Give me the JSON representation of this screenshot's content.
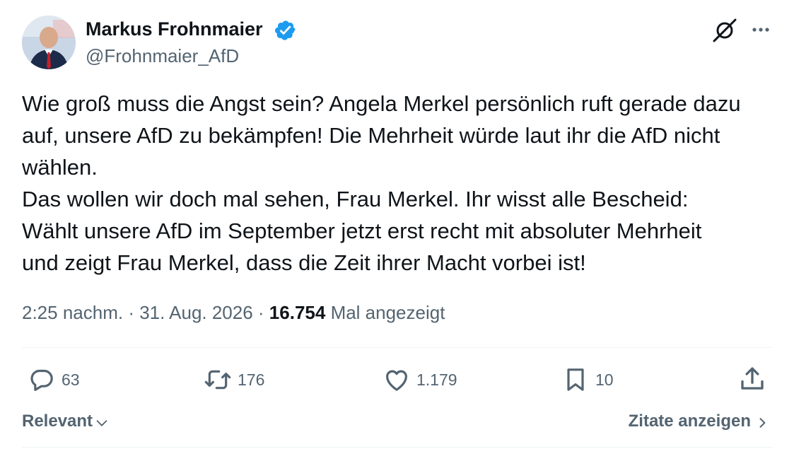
{
  "author": {
    "name": "Markus Frohnmaier",
    "handle": "@Frohnmaier_AfD",
    "verified": true,
    "verified_color": "#1d9bf0"
  },
  "tweet": {
    "text": "Wie groß muss die Angst sein? Angela Merkel persönlich ruft gerade dazu\nauf, unsere AfD zu bekämpfen! Die Mehrheit würde laut ihr die AfD nicht\nwählen.\nDas wollen wir doch mal sehen, Frau Merkel. Ihr wisst alle Bescheid:\nWählt unsere AfD im September jetzt erst recht mit absoluter Mehrheit\nund zeigt Frau Merkel, dass die Zeit ihrer Macht vorbei ist!",
    "time": "2:25 nachm.",
    "date": "31. Aug. 2026",
    "views_count": "16.754",
    "views_label": "Mal angezeigt"
  },
  "actions": {
    "replies": "63",
    "reposts": "176",
    "likes": "1.179",
    "bookmarks": "10"
  },
  "footer": {
    "sort_label": "Relevant",
    "quotes_label": "Zitate anzeigen"
  },
  "icons": [
    "grok-icon",
    "more-icon",
    "reply-icon",
    "repost-icon",
    "like-icon",
    "bookmark-icon",
    "share-icon",
    "chevron-down-icon",
    "chevron-right-icon",
    "verified-badge-icon"
  ],
  "colors": {
    "text": "#0f1419",
    "secondary": "#536471",
    "divider": "#eff3f4",
    "accent": "#1d9bf0"
  }
}
